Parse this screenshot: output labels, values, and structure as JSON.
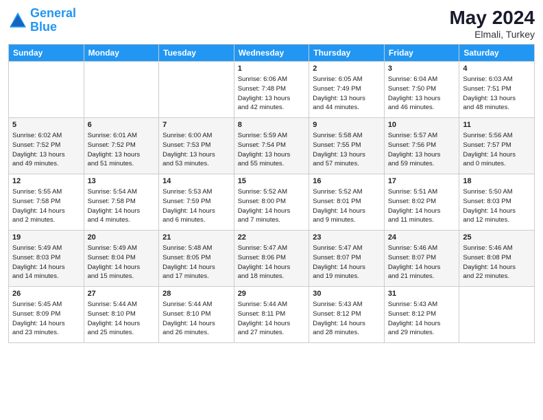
{
  "header": {
    "logo_line1": "General",
    "logo_line2": "Blue",
    "month_year": "May 2024",
    "location": "Elmali, Turkey"
  },
  "weekdays": [
    "Sunday",
    "Monday",
    "Tuesday",
    "Wednesday",
    "Thursday",
    "Friday",
    "Saturday"
  ],
  "weeks": [
    [
      {
        "day": "",
        "info": ""
      },
      {
        "day": "",
        "info": ""
      },
      {
        "day": "",
        "info": ""
      },
      {
        "day": "1",
        "info": "Sunrise: 6:06 AM\nSunset: 7:48 PM\nDaylight: 13 hours\nand 42 minutes."
      },
      {
        "day": "2",
        "info": "Sunrise: 6:05 AM\nSunset: 7:49 PM\nDaylight: 13 hours\nand 44 minutes."
      },
      {
        "day": "3",
        "info": "Sunrise: 6:04 AM\nSunset: 7:50 PM\nDaylight: 13 hours\nand 46 minutes."
      },
      {
        "day": "4",
        "info": "Sunrise: 6:03 AM\nSunset: 7:51 PM\nDaylight: 13 hours\nand 48 minutes."
      }
    ],
    [
      {
        "day": "5",
        "info": "Sunrise: 6:02 AM\nSunset: 7:52 PM\nDaylight: 13 hours\nand 49 minutes."
      },
      {
        "day": "6",
        "info": "Sunrise: 6:01 AM\nSunset: 7:52 PM\nDaylight: 13 hours\nand 51 minutes."
      },
      {
        "day": "7",
        "info": "Sunrise: 6:00 AM\nSunset: 7:53 PM\nDaylight: 13 hours\nand 53 minutes."
      },
      {
        "day": "8",
        "info": "Sunrise: 5:59 AM\nSunset: 7:54 PM\nDaylight: 13 hours\nand 55 minutes."
      },
      {
        "day": "9",
        "info": "Sunrise: 5:58 AM\nSunset: 7:55 PM\nDaylight: 13 hours\nand 57 minutes."
      },
      {
        "day": "10",
        "info": "Sunrise: 5:57 AM\nSunset: 7:56 PM\nDaylight: 13 hours\nand 59 minutes."
      },
      {
        "day": "11",
        "info": "Sunrise: 5:56 AM\nSunset: 7:57 PM\nDaylight: 14 hours\nand 0 minutes."
      }
    ],
    [
      {
        "day": "12",
        "info": "Sunrise: 5:55 AM\nSunset: 7:58 PM\nDaylight: 14 hours\nand 2 minutes."
      },
      {
        "day": "13",
        "info": "Sunrise: 5:54 AM\nSunset: 7:58 PM\nDaylight: 14 hours\nand 4 minutes."
      },
      {
        "day": "14",
        "info": "Sunrise: 5:53 AM\nSunset: 7:59 PM\nDaylight: 14 hours\nand 6 minutes."
      },
      {
        "day": "15",
        "info": "Sunrise: 5:52 AM\nSunset: 8:00 PM\nDaylight: 14 hours\nand 7 minutes."
      },
      {
        "day": "16",
        "info": "Sunrise: 5:52 AM\nSunset: 8:01 PM\nDaylight: 14 hours\nand 9 minutes."
      },
      {
        "day": "17",
        "info": "Sunrise: 5:51 AM\nSunset: 8:02 PM\nDaylight: 14 hours\nand 11 minutes."
      },
      {
        "day": "18",
        "info": "Sunrise: 5:50 AM\nSunset: 8:03 PM\nDaylight: 14 hours\nand 12 minutes."
      }
    ],
    [
      {
        "day": "19",
        "info": "Sunrise: 5:49 AM\nSunset: 8:03 PM\nDaylight: 14 hours\nand 14 minutes."
      },
      {
        "day": "20",
        "info": "Sunrise: 5:49 AM\nSunset: 8:04 PM\nDaylight: 14 hours\nand 15 minutes."
      },
      {
        "day": "21",
        "info": "Sunrise: 5:48 AM\nSunset: 8:05 PM\nDaylight: 14 hours\nand 17 minutes."
      },
      {
        "day": "22",
        "info": "Sunrise: 5:47 AM\nSunset: 8:06 PM\nDaylight: 14 hours\nand 18 minutes."
      },
      {
        "day": "23",
        "info": "Sunrise: 5:47 AM\nSunset: 8:07 PM\nDaylight: 14 hours\nand 19 minutes."
      },
      {
        "day": "24",
        "info": "Sunrise: 5:46 AM\nSunset: 8:07 PM\nDaylight: 14 hours\nand 21 minutes."
      },
      {
        "day": "25",
        "info": "Sunrise: 5:46 AM\nSunset: 8:08 PM\nDaylight: 14 hours\nand 22 minutes."
      }
    ],
    [
      {
        "day": "26",
        "info": "Sunrise: 5:45 AM\nSunset: 8:09 PM\nDaylight: 14 hours\nand 23 minutes."
      },
      {
        "day": "27",
        "info": "Sunrise: 5:44 AM\nSunset: 8:10 PM\nDaylight: 14 hours\nand 25 minutes."
      },
      {
        "day": "28",
        "info": "Sunrise: 5:44 AM\nSunset: 8:10 PM\nDaylight: 14 hours\nand 26 minutes."
      },
      {
        "day": "29",
        "info": "Sunrise: 5:44 AM\nSunset: 8:11 PM\nDaylight: 14 hours\nand 27 minutes."
      },
      {
        "day": "30",
        "info": "Sunrise: 5:43 AM\nSunset: 8:12 PM\nDaylight: 14 hours\nand 28 minutes."
      },
      {
        "day": "31",
        "info": "Sunrise: 5:43 AM\nSunset: 8:12 PM\nDaylight: 14 hours\nand 29 minutes."
      },
      {
        "day": "",
        "info": ""
      }
    ]
  ]
}
